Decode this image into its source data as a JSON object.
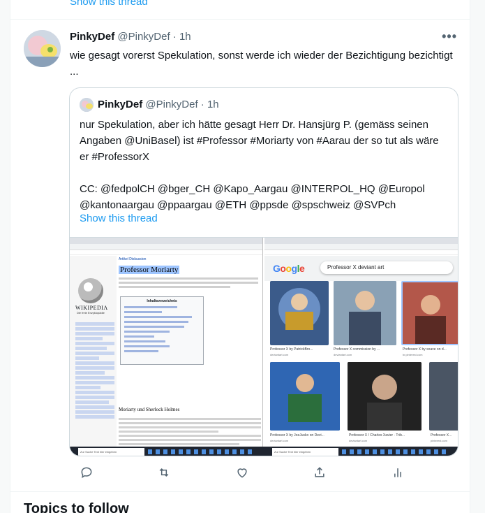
{
  "thread_link_top": "Show this thread",
  "tweet": {
    "name": "PinkyDef",
    "handle": "@PinkyDef",
    "time": "1h",
    "more": "•••",
    "text": "wie gesagt vorerst Spekulation, sonst werde ich wieder der Bezichtigung bezichtigt ...",
    "quoted": {
      "name": "PinkyDef",
      "handle": "@PinkyDef",
      "time": "1h",
      "text": "nur Spekulation, aber ich hätte gesagt Herr Dr. Hansjürg P. (gemäss seinen Angaben @UniBasel) ist #Professor #Moriarty von #Aarau der so tut als wäre er #ProfessorX\n\nCC: @fedpolCH @bger_CH @Kapo_Aargau @INTERPOL_HQ @Europol @kantonaargau @ppaargau @ETH @ppsde @spschweiz @SVPch",
      "thread_link": "Show this thread",
      "screenshot": {
        "wiki": {
          "logo_word": "WIKIPEDIA",
          "logo_sub": "Die freie Enzyklopädie",
          "tabs": "Artikel  Diskussion",
          "title": "Professor Moriarty",
          "toc_title": "Inhaltsverzeichnis",
          "section": "Moriarty und Sherlock Holmes"
        },
        "google": {
          "logo": "Google",
          "query": "Professor X deviant art",
          "results": [
            {
              "caption": "Professor X by PatrickBro...",
              "source": "deviantart.com"
            },
            {
              "caption": "Professor X commission by ...",
              "source": "deviantart.com"
            },
            {
              "caption": "Professor X by soave on d...",
              "source": "br.pinterest.com"
            },
            {
              "caption": "Professor X by JoeJusko on Devi...",
              "source": "deviantart.com"
            },
            {
              "caption": "Professor X / Charles Xavier · Trib...",
              "source": "deviantart.com"
            },
            {
              "caption": "Professor X...",
              "source": "pinterest.com"
            }
          ]
        },
        "taskbar_search": "Zur Suche Text hier eingeben"
      }
    }
  },
  "actions": [
    "reply-icon",
    "retweet-icon",
    "like-icon",
    "share-icon",
    "analytics-icon"
  ],
  "topics_heading": "Topics to follow",
  "colors": {
    "link": "#1d9bf0",
    "muted": "#536471",
    "text": "#0f1419",
    "border": "#cfd9de"
  }
}
